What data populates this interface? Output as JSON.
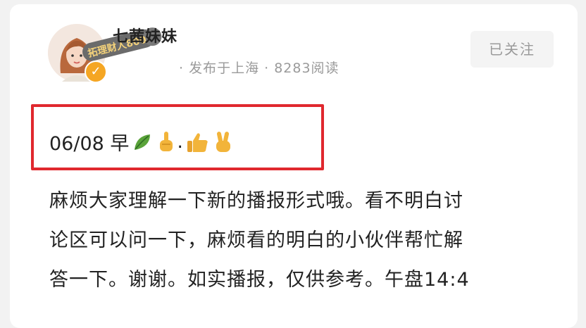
{
  "author": {
    "name": "七茜妹妹",
    "badge_text": "拓理财人800",
    "verified": true
  },
  "post_meta": {
    "text": "· 发布于上海 · 8283阅读"
  },
  "follow_button": {
    "label": "已关注"
  },
  "post": {
    "title": "06/08 早",
    "title_emoji": [
      "leaf-emoji",
      "pointing-up-emoji",
      "thumbs-up-emoji",
      "victory-hand-emoji"
    ],
    "title_separator": ".",
    "body_lines": [
      "麻烦大家理解一下新的播报形式哦。看不明白讨",
      "论区可以问一下，麻烦看的明白的小伙伴帮忙解",
      "答一下。谢谢。如实播报，仅供参考。午盘14:4"
    ]
  },
  "colors": {
    "highlight_border": "#e0282e",
    "verified_badge": "#f5a623",
    "meta_text": "#9a9a9a"
  }
}
